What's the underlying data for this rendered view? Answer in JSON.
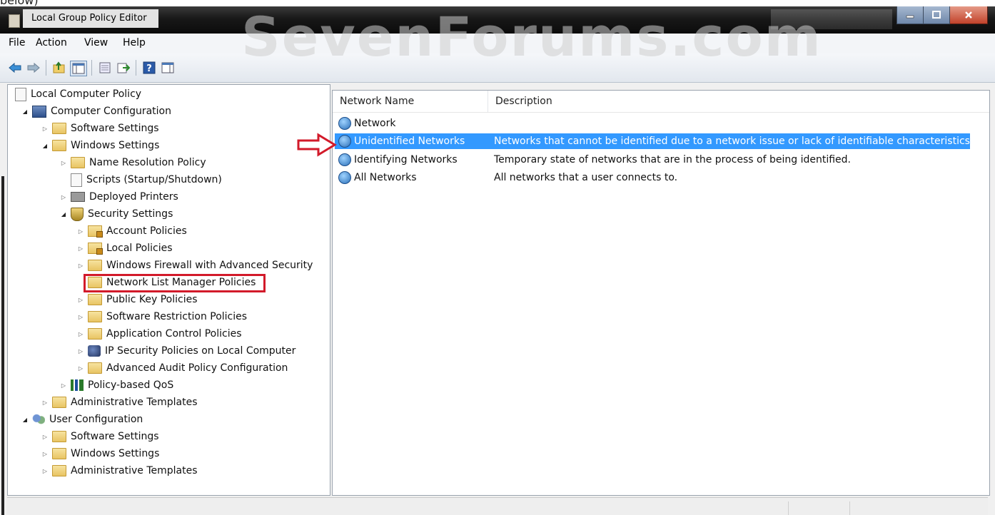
{
  "page_top_text": "below)",
  "window": {
    "title": "Local Group Policy Editor"
  },
  "watermark": "SevenForums.com",
  "menubar": {
    "items": [
      "File",
      "Action",
      "View",
      "Help"
    ]
  },
  "toolbar": {
    "buttons": [
      "back-icon",
      "forward-icon",
      "up-folder-icon",
      "show-hide-tree-icon",
      "properties-icon",
      "export-list-icon",
      "help-icon",
      "show-hide-action-pane-icon"
    ]
  },
  "tree": {
    "root": "Local Computer Policy",
    "computer_config": "Computer Configuration",
    "software_settings": "Software Settings",
    "windows_settings": "Windows Settings",
    "name_resolution_policy": "Name Resolution Policy",
    "scripts": "Scripts (Startup/Shutdown)",
    "deployed_printers": "Deployed Printers",
    "security_settings": "Security Settings",
    "account_policies": "Account Policies",
    "local_policies": "Local Policies",
    "windows_firewall": "Windows Firewall with Advanced Security",
    "network_list_manager": "Network List Manager Policies",
    "public_key_policies": "Public Key Policies",
    "software_restriction": "Software Restriction Policies",
    "application_control": "Application Control Policies",
    "ip_security": "IP Security Policies on Local Computer",
    "advanced_audit": "Advanced Audit Policy Configuration",
    "policy_qos": "Policy-based QoS",
    "admin_templates": "Administrative Templates",
    "user_config": "User Configuration",
    "user_software_settings": "Software Settings",
    "user_windows_settings": "Windows Settings",
    "user_admin_templates": "Administrative Templates"
  },
  "list": {
    "columns": {
      "name": "Network Name",
      "description": "Description"
    },
    "rows": [
      {
        "name": "Network",
        "description": ""
      },
      {
        "name": "Unidentified Networks",
        "description": "Networks that cannot be identified due to a network issue or lack of identifiable characteristics."
      },
      {
        "name": "Identifying Networks",
        "description": "Temporary state of networks that are in the process of being identified."
      },
      {
        "name": "All Networks",
        "description": "All networks that a user connects to."
      }
    ],
    "selected_index": 1
  },
  "colors": {
    "selection": "#3399ff",
    "annotation": "#d21a2a"
  }
}
